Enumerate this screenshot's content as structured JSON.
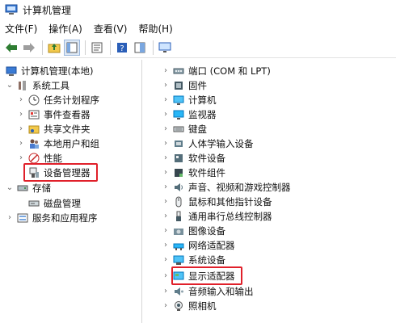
{
  "window": {
    "title": "计算机管理"
  },
  "menu": {
    "file": "文件(F)",
    "action": "操作(A)",
    "view": "查看(V)",
    "help": "帮助(H)"
  },
  "tree": {
    "root": "计算机管理(本地)",
    "system_tools": "系统工具",
    "task_scheduler": "任务计划程序",
    "event_viewer": "事件查看器",
    "shared_folders": "共享文件夹",
    "local_users": "本地用户和组",
    "performance": "性能",
    "device_manager": "设备管理器",
    "storage": "存储",
    "disk_management": "磁盘管理",
    "services_apps": "服务和应用程序"
  },
  "devices": [
    "端口 (COM 和 LPT)",
    "固件",
    "计算机",
    "监视器",
    "键盘",
    "人体学输入设备",
    "软件设备",
    "软件组件",
    "声音、视频和游戏控制器",
    "鼠标和其他指针设备",
    "通用串行总线控制器",
    "图像设备",
    "网络适配器",
    "系统设备",
    "显示适配器",
    "音频输入和输出",
    "照相机"
  ],
  "colors": {
    "highlight": "#e0202a"
  }
}
